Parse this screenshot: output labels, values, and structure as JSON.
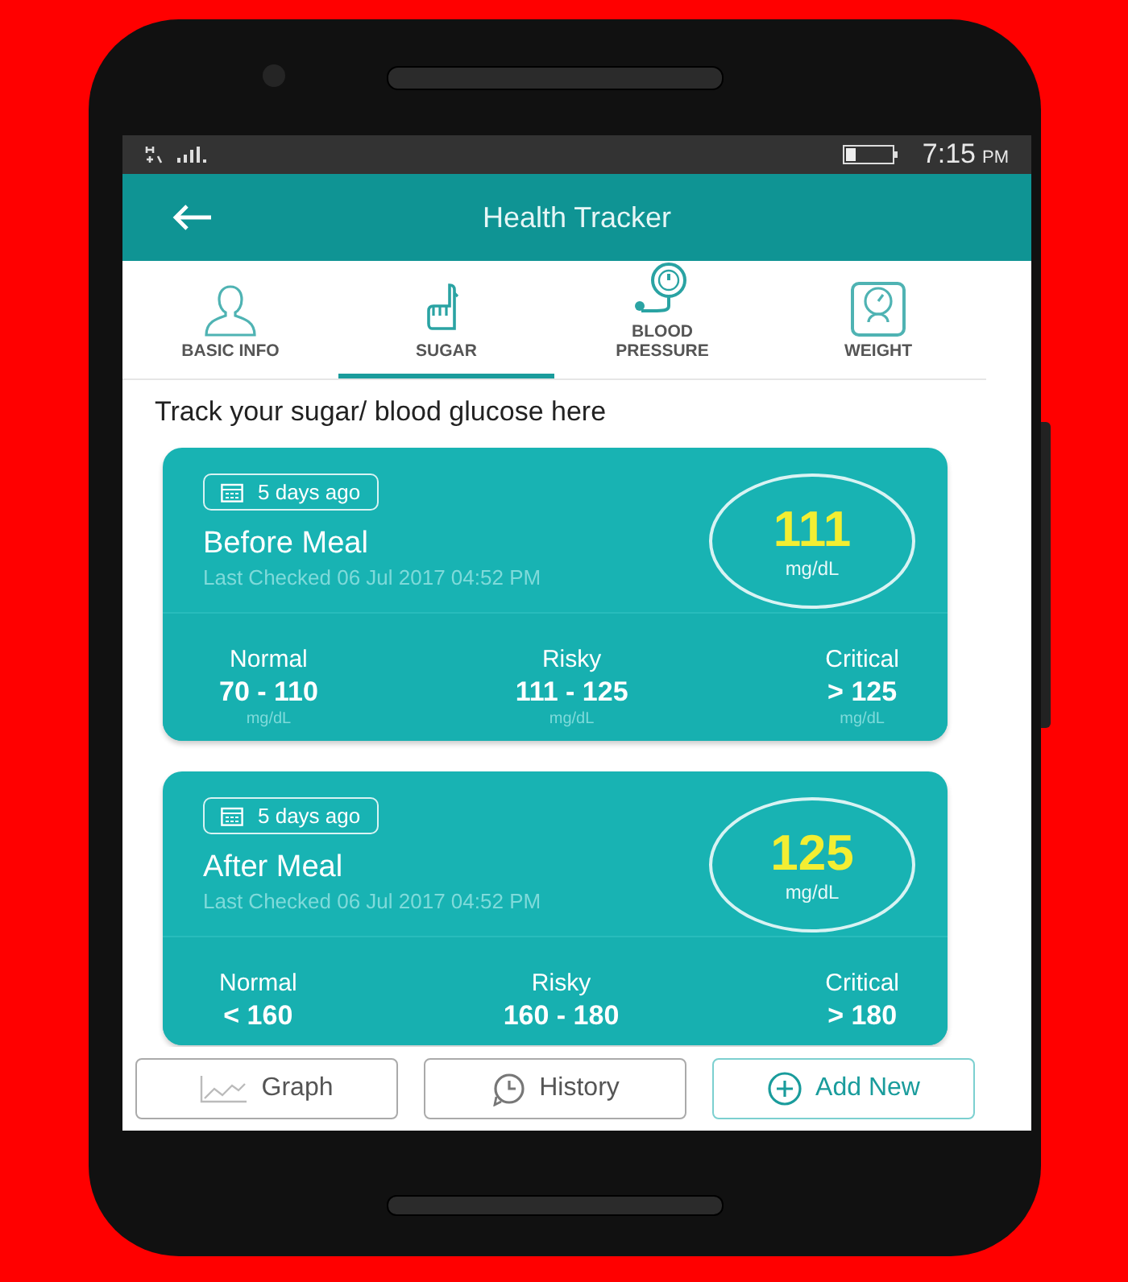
{
  "status_bar": {
    "time": "7:15",
    "meridiem": "PM"
  },
  "app_bar": {
    "title": "Health Tracker"
  },
  "tabs": [
    {
      "label": "BASIC INFO",
      "kind": "person",
      "selected": false
    },
    {
      "label": "SUGAR",
      "kind": "finger",
      "selected": true
    },
    {
      "label": "BLOOD PRESSURE",
      "kind": "gauge",
      "selected": false
    },
    {
      "label": "WEIGHT",
      "kind": "scale",
      "selected": false
    }
  ],
  "heading": "Track your sugar/ blood glucose here",
  "cards": [
    {
      "badge": "5 days ago",
      "title": "Before Meal",
      "last_checked": "Last Checked 06 Jul 2017 04:52 PM",
      "reading": "111",
      "reading_unit": "mg/dL",
      "ranges": [
        {
          "label": "Normal",
          "value": "70 - 110",
          "unit": "mg/dL"
        },
        {
          "label": "Risky",
          "value": "111 - 125",
          "unit": "mg/dL"
        },
        {
          "label": "Critical",
          "value": "> 125",
          "unit": "mg/dL"
        }
      ]
    },
    {
      "badge": "5 days ago",
      "title": "After Meal",
      "last_checked": "Last Checked 06 Jul 2017 04:52 PM",
      "reading": "125",
      "reading_unit": "mg/dL",
      "ranges": [
        {
          "label": "Normal",
          "value": "< 160"
        },
        {
          "label": "Risky",
          "value": "160 - 180"
        },
        {
          "label": "Critical",
          "value": "> 180"
        }
      ]
    }
  ],
  "buttons": [
    {
      "label": "Graph",
      "kind": "outline"
    },
    {
      "label": "History",
      "kind": "outline"
    },
    {
      "label": "Add New",
      "kind": "primary"
    }
  ]
}
